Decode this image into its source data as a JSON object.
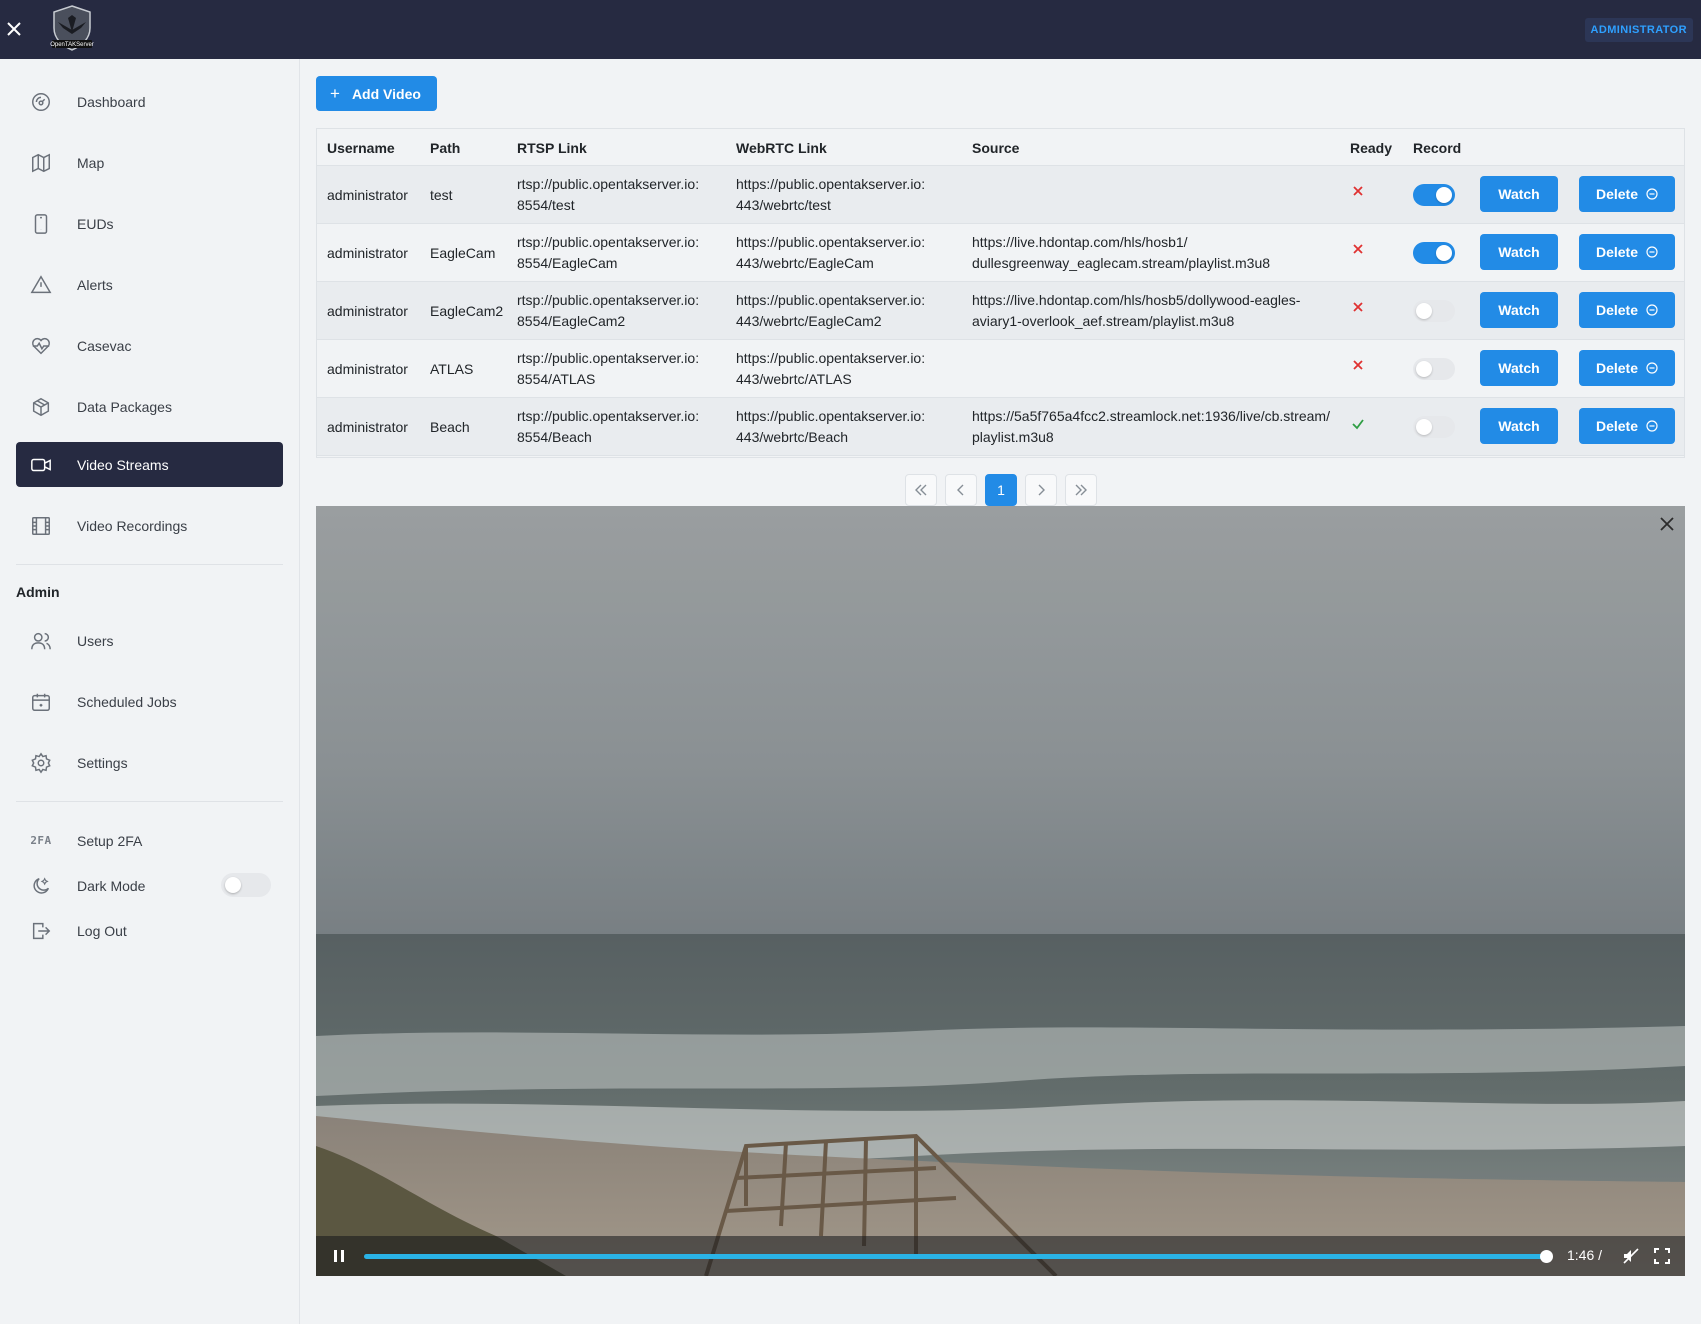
{
  "header": {
    "logo_text": "OpenTAKServer",
    "role_badge": "ADMINISTRATOR"
  },
  "sidebar": {
    "items": [
      {
        "label": "Dashboard",
        "icon": "gauge-icon"
      },
      {
        "label": "Map",
        "icon": "map-icon"
      },
      {
        "label": "EUDs",
        "icon": "phone-icon"
      },
      {
        "label": "Alerts",
        "icon": "alert-triangle-icon"
      },
      {
        "label": "Casevac",
        "icon": "heartbeat-icon"
      },
      {
        "label": "Data Packages",
        "icon": "package-icon"
      },
      {
        "label": "Video Streams",
        "icon": "video-camera-icon",
        "active": true
      },
      {
        "label": "Video Recordings",
        "icon": "film-icon"
      }
    ],
    "admin_title": "Admin",
    "admin_items": [
      {
        "label": "Users",
        "icon": "users-icon"
      },
      {
        "label": "Scheduled Jobs",
        "icon": "calendar-icon"
      },
      {
        "label": "Settings",
        "icon": "gear-icon"
      }
    ],
    "setup_2fa": {
      "label": "Setup 2FA",
      "icon_text": "2FA"
    },
    "dark_mode": {
      "label": "Dark Mode",
      "enabled": false
    },
    "logout": {
      "label": "Log Out"
    }
  },
  "main": {
    "add_video_label": "Add Video",
    "table": {
      "headers": [
        "Username",
        "Path",
        "RTSP Link",
        "WebRTC Link",
        "Source",
        "Ready",
        "Record"
      ],
      "rows": [
        {
          "username": "administrator",
          "path": "test",
          "rtsp1": "rtsp://public.opentakserver.io:",
          "rtsp2": "8554/test",
          "webrtc1": "https://public.opentakserver.io:",
          "webrtc2": "443/webrtc/test",
          "source1": "",
          "source2": "",
          "ready": false,
          "record": true,
          "watch": "Watch",
          "delete": "Delete"
        },
        {
          "username": "administrator",
          "path": "EagleCam",
          "rtsp1": "rtsp://public.opentakserver.io:",
          "rtsp2": "8554/EagleCam",
          "webrtc1": "https://public.opentakserver.io:",
          "webrtc2": "443/webrtc/EagleCam",
          "source1": "https://live.hdontap.com/hls/hosb1/",
          "source2": "dullesgreenway_eaglecam.stream/playlist.m3u8",
          "ready": false,
          "record": true,
          "watch": "Watch",
          "delete": "Delete"
        },
        {
          "username": "administrator",
          "path": "EagleCam2",
          "rtsp1": "rtsp://public.opentakserver.io:",
          "rtsp2": "8554/EagleCam2",
          "webrtc1": "https://public.opentakserver.io:",
          "webrtc2": "443/webrtc/EagleCam2",
          "source1": "https://live.hdontap.com/hls/hosb5/dollywood-eagles-",
          "source2": "aviary1-overlook_aef.stream/playlist.m3u8",
          "ready": false,
          "record": false,
          "watch": "Watch",
          "delete": "Delete"
        },
        {
          "username": "administrator",
          "path": "ATLAS",
          "rtsp1": "rtsp://public.opentakserver.io:",
          "rtsp2": "8554/ATLAS",
          "webrtc1": "https://public.opentakserver.io:",
          "webrtc2": "443/webrtc/ATLAS",
          "source1": "",
          "source2": "",
          "ready": false,
          "record": false,
          "watch": "Watch",
          "delete": "Delete"
        },
        {
          "username": "administrator",
          "path": "Beach",
          "rtsp1": "rtsp://public.opentakserver.io:",
          "rtsp2": "8554/Beach",
          "webrtc1": "https://public.opentakserver.io:",
          "webrtc2": "443/webrtc/Beach",
          "source1": "https://5a5f765a4fcc2.streamlock.net:1936/live/cb.stream/",
          "source2": "playlist.m3u8",
          "ready": true,
          "record": false,
          "watch": "Watch",
          "delete": "Delete"
        }
      ]
    },
    "pagination": {
      "current_page": "1"
    },
    "player": {
      "time": "1:46 /",
      "progress": 0.995,
      "state": "playing"
    }
  },
  "colors": {
    "header_bg": "#262a41",
    "accent": "#228be6",
    "ready_false": "#e03131",
    "ready_true": "#2f9e44"
  }
}
